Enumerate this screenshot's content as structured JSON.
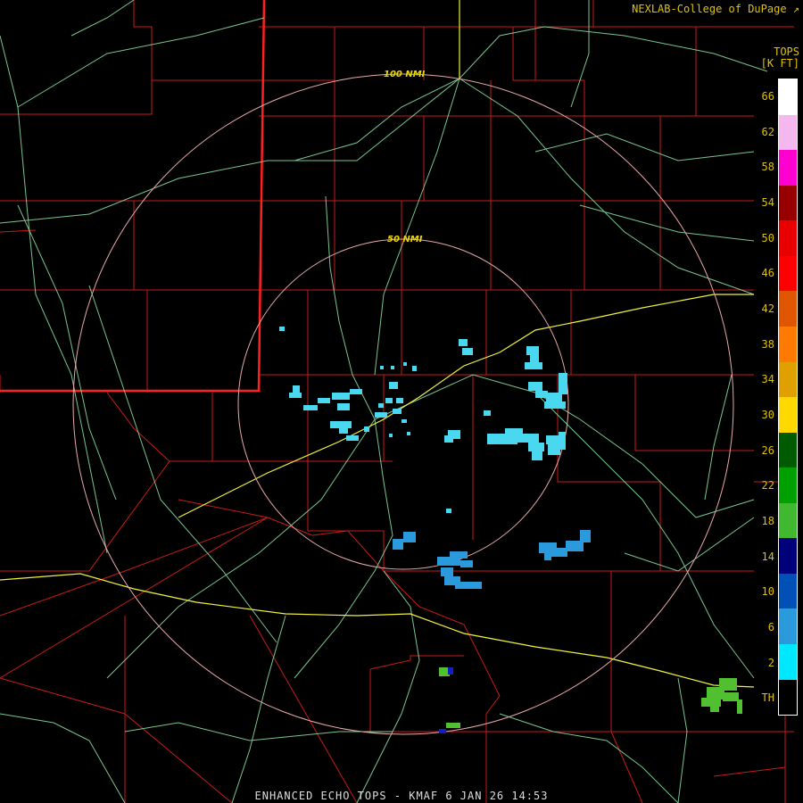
{
  "credit": "NEXLAB-College of DuPage",
  "legend": {
    "title_line1": "TOPS",
    "title_line2": "[K FT]",
    "labels": [
      "66",
      "62",
      "58",
      "54",
      "50",
      "46",
      "42",
      "38",
      "34",
      "30",
      "26",
      "22",
      "18",
      "14",
      "10",
      "6",
      "2",
      "TH"
    ],
    "colors": [
      "#ffffff",
      "#f4b8ee",
      "#ff00d0",
      "#980000",
      "#e80000",
      "#ff0000",
      "#e05500",
      "#ff7a00",
      "#e0a000",
      "#ffd800",
      "#005a00",
      "#00a000",
      "#40b830",
      "#00007a",
      "#0050b8",
      "#2a9adc",
      "#00e8ff",
      "#000000"
    ]
  },
  "rings": [
    {
      "label": "100 NMI"
    },
    {
      "label": "50 NMI"
    }
  ],
  "footer": "ENHANCED ECHO TOPS - KMAF  6 JAN 26 14:53",
  "map_colors": {
    "county_lines": "#c81a1a",
    "state_line": "#ff2020",
    "roads": "#8fe8a8",
    "interstates": "#f2f23c",
    "range_rings": "#e8a8a8",
    "echo_low": "#4ad8f0",
    "echo_mid": "#2a9adc",
    "echo_green": "#50c030"
  }
}
